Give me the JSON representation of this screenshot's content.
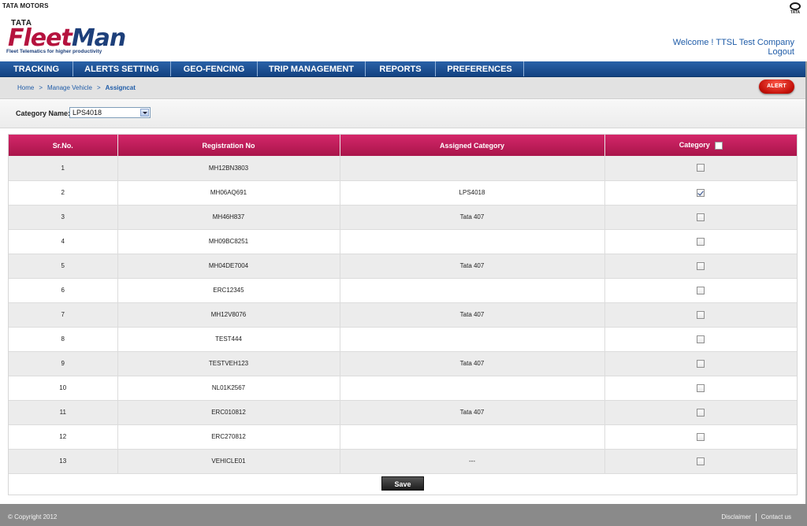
{
  "header": {
    "top_brand": "TATA MOTORS",
    "logo_tata": "TATA",
    "logo_fleet": "Fleet",
    "logo_man": "Man",
    "logo_tagline": "Fleet Telematics for higher productivity",
    "right_mark": "TATA",
    "welcome": "Welcome ! TTSL Test Company",
    "logout": "Logout"
  },
  "nav": {
    "items": [
      {
        "label": "TRACKING"
      },
      {
        "label": "ALERTS SETTING"
      },
      {
        "label": "GEO-FENCING"
      },
      {
        "label": "TRIP MANAGEMENT"
      },
      {
        "label": "REPORTS"
      },
      {
        "label": "PREFERENCES"
      }
    ]
  },
  "breadcrumb": {
    "items": [
      "Home",
      "Manage Vehicle",
      "Assigncat"
    ],
    "separator": ">"
  },
  "alert_button": "ALERT",
  "category": {
    "label": "Category Name:",
    "selected": "LPS4018"
  },
  "table": {
    "columns": [
      "Sr.No.",
      "Registration No",
      "Assigned Category",
      "Category"
    ],
    "rows": [
      {
        "sr": "1",
        "reg": "MH12BN3803",
        "assigned": "",
        "checked": false
      },
      {
        "sr": "2",
        "reg": "MH06AQ691",
        "assigned": "LPS4018",
        "checked": true
      },
      {
        "sr": "3",
        "reg": "MH46H837",
        "assigned": "Tata 407",
        "checked": false
      },
      {
        "sr": "4",
        "reg": "MH09BC8251",
        "assigned": "",
        "checked": false
      },
      {
        "sr": "5",
        "reg": "MH04DE7004",
        "assigned": "Tata 407",
        "checked": false
      },
      {
        "sr": "6",
        "reg": "ERC12345",
        "assigned": "",
        "checked": false
      },
      {
        "sr": "7",
        "reg": "MH12V8076",
        "assigned": "Tata 407",
        "checked": false
      },
      {
        "sr": "8",
        "reg": "TEST444",
        "assigned": "",
        "checked": false
      },
      {
        "sr": "9",
        "reg": "TESTVEH123",
        "assigned": "Tata 407",
        "checked": false
      },
      {
        "sr": "10",
        "reg": "NL01K2567",
        "assigned": "",
        "checked": false
      },
      {
        "sr": "11",
        "reg": "ERC010812",
        "assigned": "Tata 407",
        "checked": false
      },
      {
        "sr": "12",
        "reg": "ERC270812",
        "assigned": "",
        "checked": false
      },
      {
        "sr": "13",
        "reg": "VEHICLE01",
        "assigned": "---",
        "checked": false
      }
    ]
  },
  "save_label": "Save",
  "footer": {
    "copyright": "© Copyright 2012",
    "disclaimer": "Disclaimer",
    "contact": "Contact us"
  },
  "colors": {
    "nav_blue": "#134281",
    "header_magenta": "#b5123e",
    "link_blue": "#1f5ca8"
  }
}
